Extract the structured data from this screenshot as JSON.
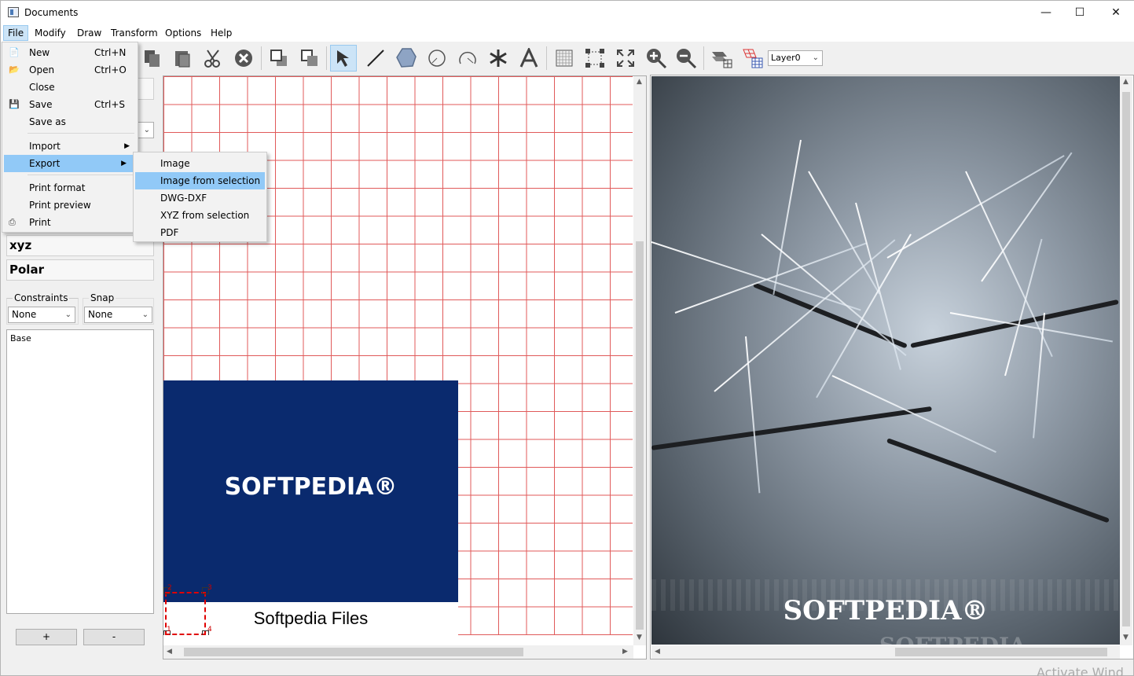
{
  "window": {
    "title": "Documents",
    "minimize": "—",
    "maximize": "☐",
    "close": "✕"
  },
  "menubar": [
    "File",
    "Modify",
    "Draw",
    "Transform",
    "Options",
    "Help"
  ],
  "toolbar": {
    "layer_value": "Layer0"
  },
  "file_menu": {
    "items": [
      {
        "label": "New",
        "shortcut": "Ctrl+N"
      },
      {
        "label": "Open",
        "shortcut": "Ctrl+O"
      },
      {
        "label": "Close",
        "shortcut": ""
      },
      {
        "label": "Save",
        "shortcut": "Ctrl+S"
      },
      {
        "label": "Save as",
        "shortcut": ""
      },
      {
        "label": "Import",
        "shortcut": ""
      },
      {
        "label": "Export",
        "shortcut": ""
      },
      {
        "label": "Print format",
        "shortcut": ""
      },
      {
        "label": "Print preview",
        "shortcut": ""
      },
      {
        "label": "Print",
        "shortcut": ""
      }
    ]
  },
  "export_menu": {
    "items": [
      "Image",
      "Image from selection",
      "DWG-DXF",
      "XYZ from selection",
      "PDF"
    ]
  },
  "left_panel": {
    "xyz_label": "xyz",
    "polar_label": "Polar",
    "constraints_label": "Constraints",
    "snap_label": "Snap",
    "constraints_value": "None",
    "snap_value": "None",
    "layers": [
      "Base"
    ],
    "add_label": "+",
    "remove_label": "-"
  },
  "canvas": {
    "logo_text": "SOFTPEDIA®",
    "caption": "Softpedia Files",
    "handles": [
      "1",
      "2",
      "3",
      "4"
    ]
  },
  "image_pane": {
    "logo_text": "SOFTPEDIA®",
    "logo_reflection": "SOFTPEDIA"
  },
  "watermark": "Activate Wind"
}
